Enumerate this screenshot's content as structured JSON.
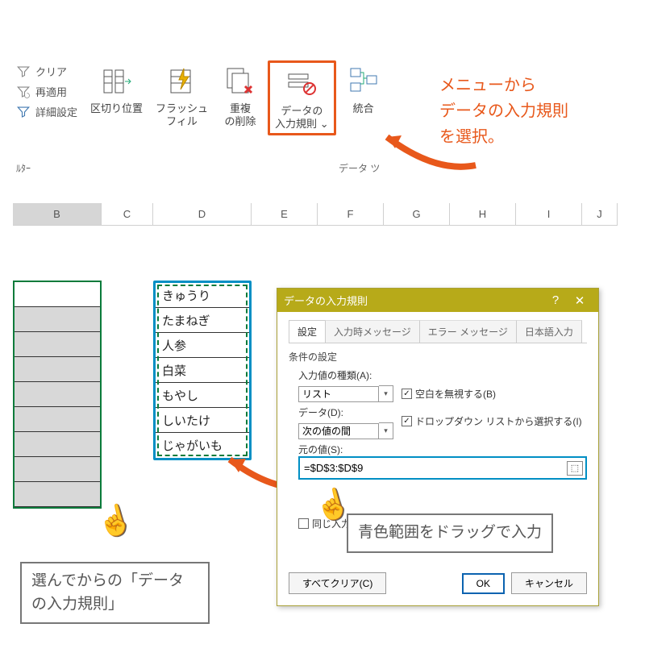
{
  "ribbon": {
    "filter_group_label": "ﾙﾀｰ",
    "data_tools_group_label": "データ ツ",
    "small": {
      "clear": "クリア",
      "reapply": "再適用",
      "advanced": "詳細設定"
    },
    "buttons": {
      "text_to_columns": "区切り位置",
      "flash_fill": "フラッシュ\nフィル",
      "remove_duplicates": "重複\nの削除",
      "data_validation": "データの\n入力規則",
      "consolidate": "統合"
    },
    "dropdown_glyph": "⌄"
  },
  "annotations": {
    "menu_hint": "メニューから\nデータの入力規則\nを選択。",
    "select_first": "選んでからの「データ\nの入力規則」",
    "drag_hint": "青色範囲をドラッグで入力"
  },
  "sheet": {
    "cols": [
      "B",
      "C",
      "D",
      "E",
      "F",
      "G",
      "H",
      "I",
      "J"
    ],
    "d_values": [
      "きゅうり",
      "たまねぎ",
      "人参",
      "白菜",
      "もやし",
      "しいたけ",
      "じゃがいも"
    ]
  },
  "dialog": {
    "title": "データの入力規則",
    "tabs": [
      "設定",
      "入力時メッセージ",
      "エラー メッセージ",
      "日本語入力"
    ],
    "section": "条件の設定",
    "allow_label": "入力値の種類(A):",
    "allow_value": "リスト",
    "ignore_blank": "空白を無視する(B)",
    "in_cell_dropdown": "ドロップダウン リストから選択する(I)",
    "data_label": "データ(D):",
    "data_value": "次の値の間",
    "source_label": "元の値(S):",
    "source_value": "=$D$3:$D$9",
    "apply_same": "同じ入力",
    "clear_all": "すべてクリア(C)",
    "ok": "OK",
    "cancel": "キャンセル",
    "help": "?",
    "close": "✕"
  }
}
